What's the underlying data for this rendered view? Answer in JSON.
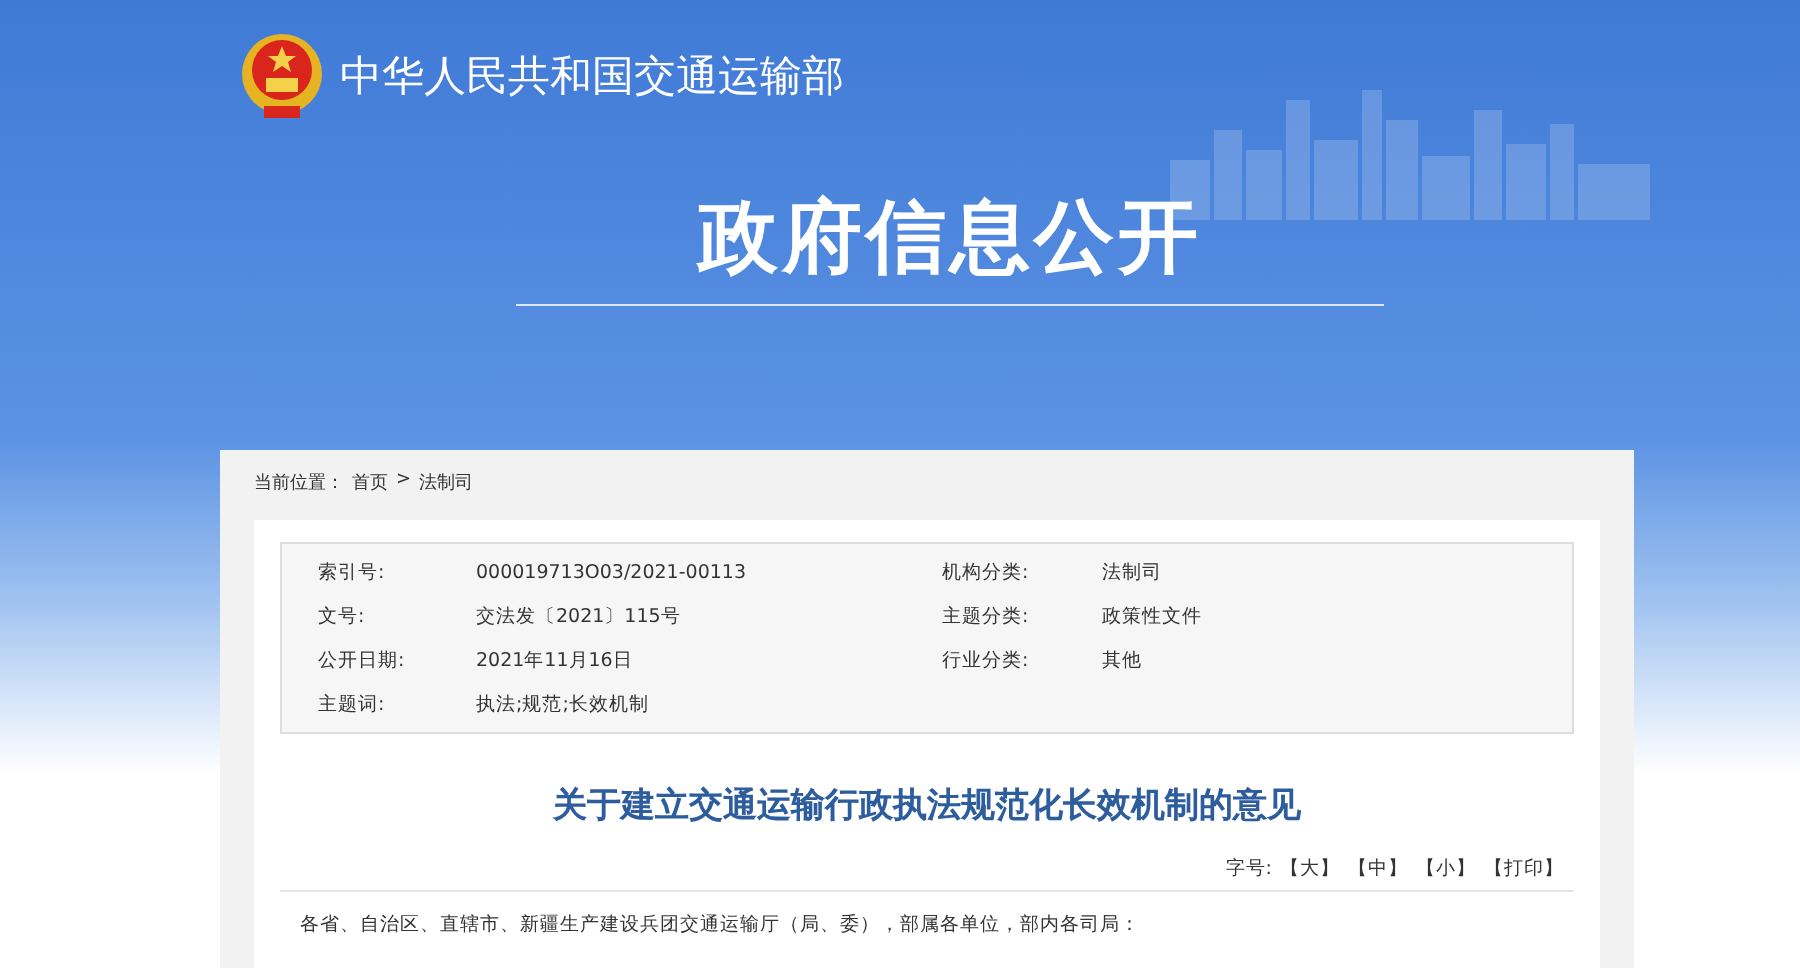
{
  "header": {
    "ministry_name": "中华人民共和国交通运输部",
    "section_title": "政府信息公开"
  },
  "breadcrumb": {
    "label": "当前位置：",
    "items": [
      "首页",
      ">",
      "法制司"
    ]
  },
  "meta": [
    {
      "label": "索引号:",
      "value": "000019713O03/2021-00113",
      "label_2": "机构分类:",
      "value_2": "法制司"
    },
    {
      "label": "文号:",
      "value": "交法发〔2021〕115号",
      "label_2": "主题分类:",
      "value_2": "政策性文件"
    },
    {
      "label": "公开日期:",
      "value": "2021年11月16日",
      "label_2": "行业分类:",
      "value_2": "其他"
    },
    {
      "label": "主题词:",
      "value": "执法;规范;长效机制"
    }
  ],
  "article": {
    "title": "关于建立交通运输行政执法规范化长效机制的意见",
    "font_size_label": "字号:",
    "tools": [
      "【大】",
      "【中】",
      "【小】",
      "【打印】"
    ],
    "body": "各省、自治区、直辖市、新疆生产建设兵团交通运输厅（局、委），部属各单位，部内各司局："
  }
}
